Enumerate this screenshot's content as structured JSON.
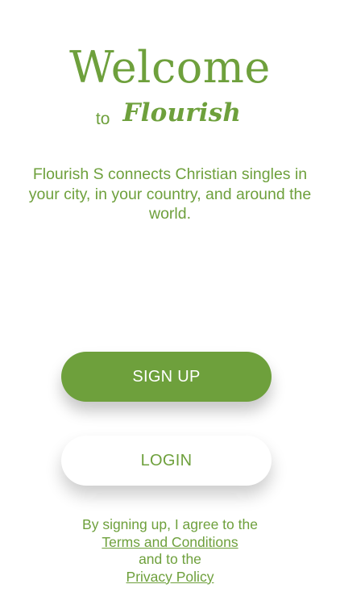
{
  "header": {
    "title": "Welcome",
    "subtitle_prefix": "to",
    "brand_name": "Flourish"
  },
  "tagline": "Flourish S connects Christian singles in your city, in your country, and around the world.",
  "buttons": {
    "signup_label": "SIGN UP",
    "login_label": "LOGIN"
  },
  "legal": {
    "line1": "By signing up, I agree to the",
    "terms_link": "Terms and Conditions",
    "line2": "and to the",
    "privacy_link": "Privacy Policy"
  },
  "colors": {
    "brand_green": "#6ea03c",
    "background": "#ffffff",
    "button_text_on_green": "#ffffff"
  }
}
